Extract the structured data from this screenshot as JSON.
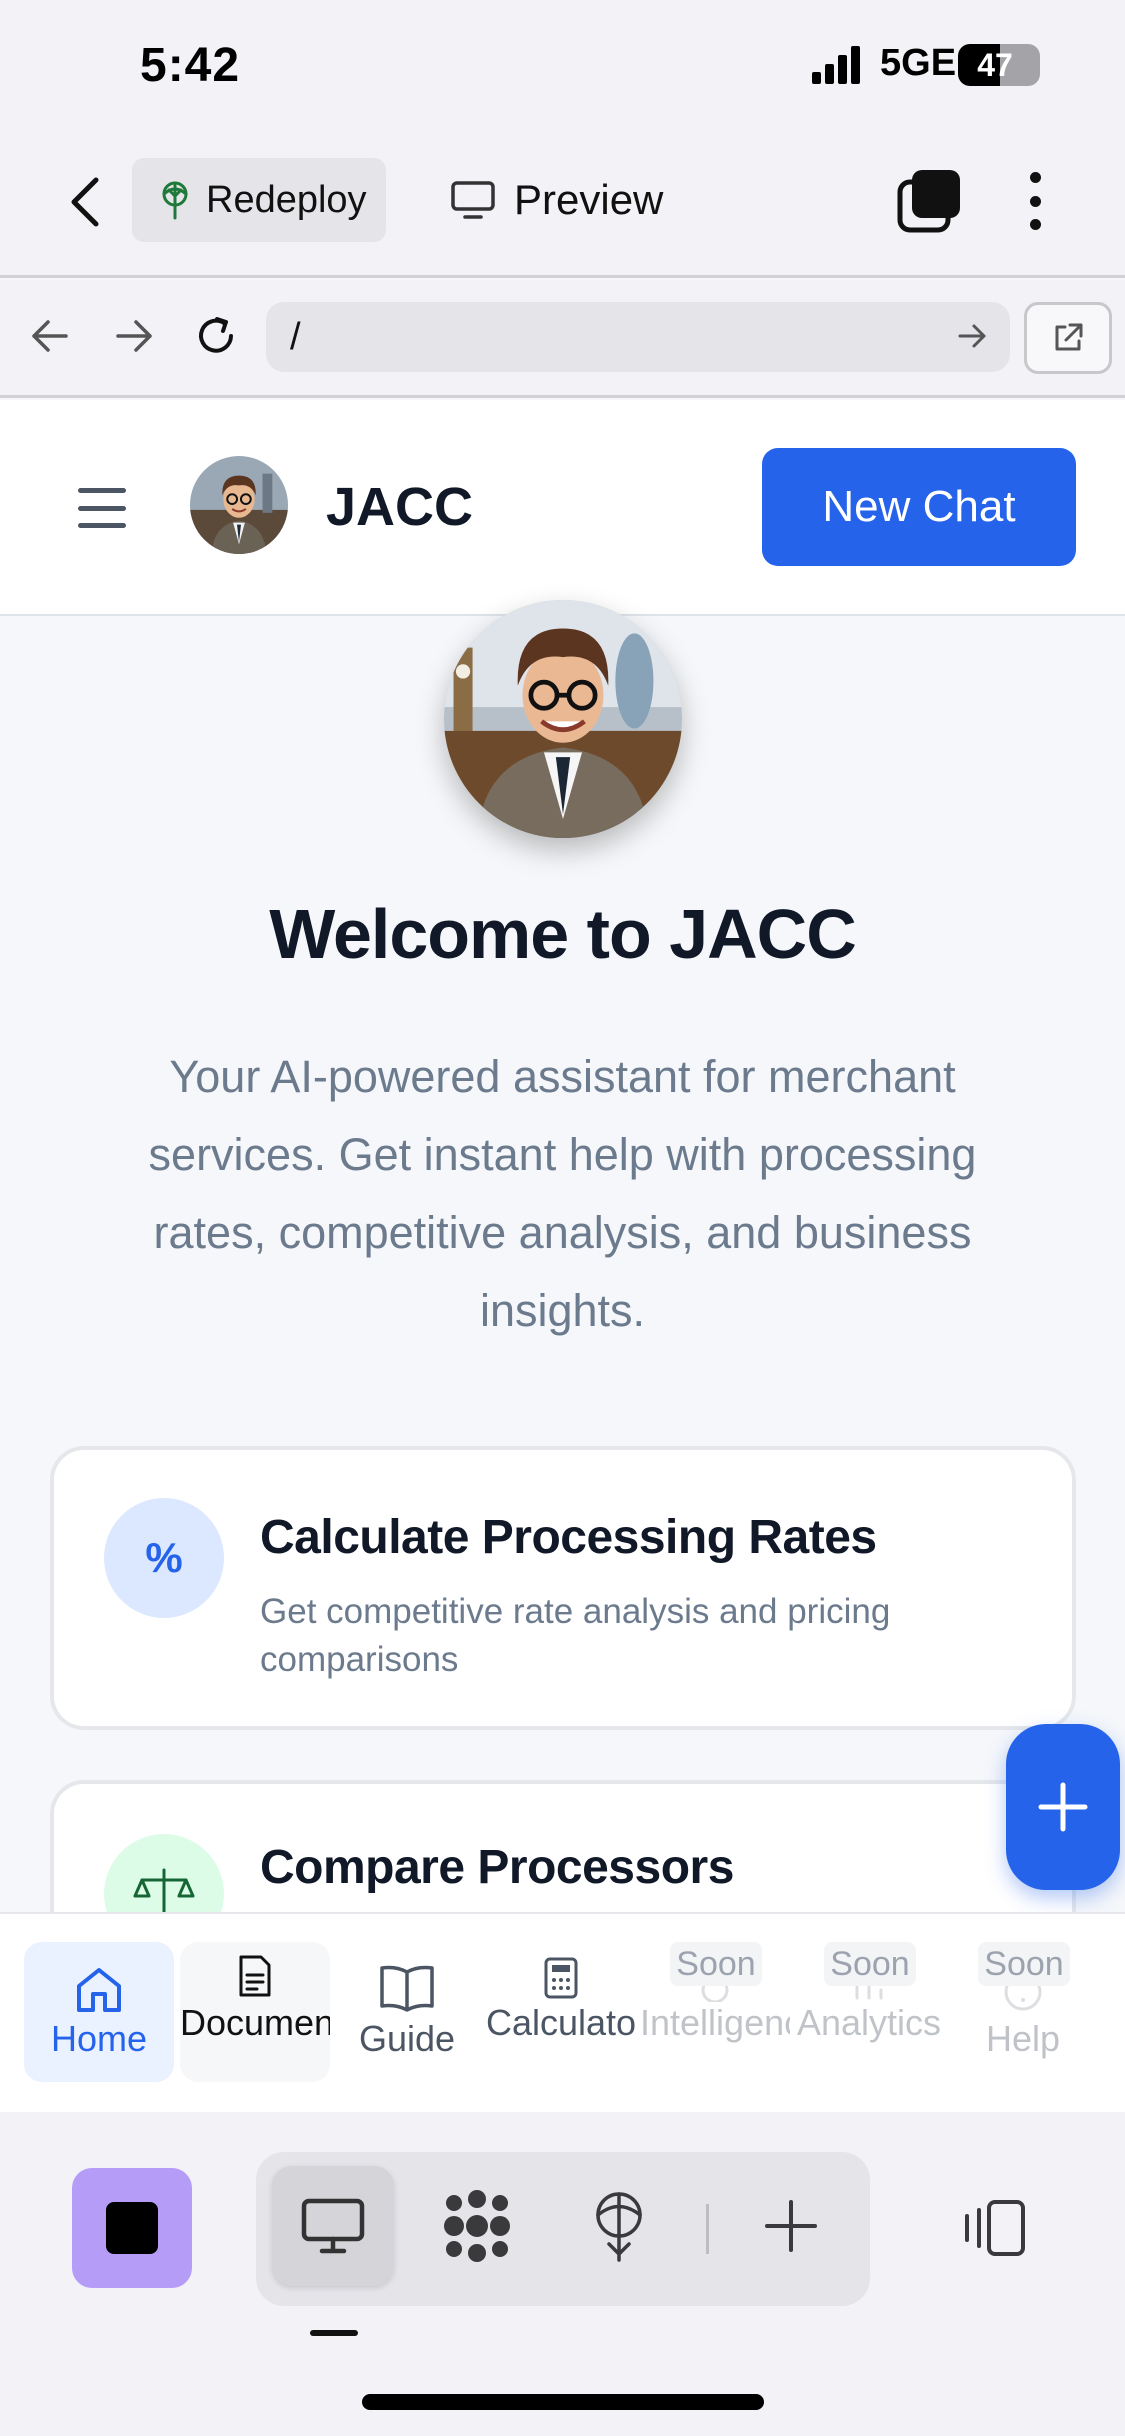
{
  "status_bar": {
    "time": "5:42",
    "network": "5GE",
    "battery": "47"
  },
  "app_toolbar": {
    "redeploy_label": "Redeploy",
    "preview_label": "Preview"
  },
  "browser": {
    "url": "/"
  },
  "site": {
    "brand": "JACC",
    "new_chat_label": "New Chat",
    "accent_color": "#2563eb"
  },
  "hero": {
    "title": "Welcome to JACC",
    "subtitle": "Your AI-powered assistant for merchant services. Get instant help with processing rates, competitive analysis, and business insights."
  },
  "cards": [
    {
      "icon": "%",
      "title": "Calculate Processing Rates",
      "description": "Get competitive rate analysis and pricing comparisons"
    },
    {
      "icon": "scale-icon",
      "title": "Compare Processors",
      "description": ""
    }
  ],
  "bottom_nav": {
    "items": [
      {
        "label": "Home",
        "icon": "home-icon"
      },
      {
        "label": "Documents",
        "icon": "document-icon"
      },
      {
        "label": "Guide",
        "icon": "book-icon"
      },
      {
        "label": "Calculator",
        "icon": "calculator-icon"
      },
      {
        "label": "Intelligence",
        "icon": "intelligence-icon",
        "badge": "Soon"
      },
      {
        "label": "Analytics",
        "icon": "chart-icon",
        "badge": "Soon"
      },
      {
        "label": "Help",
        "icon": "help-icon",
        "badge": "Soon"
      }
    ]
  },
  "replit_bar": {
    "active_tool": "preview"
  }
}
